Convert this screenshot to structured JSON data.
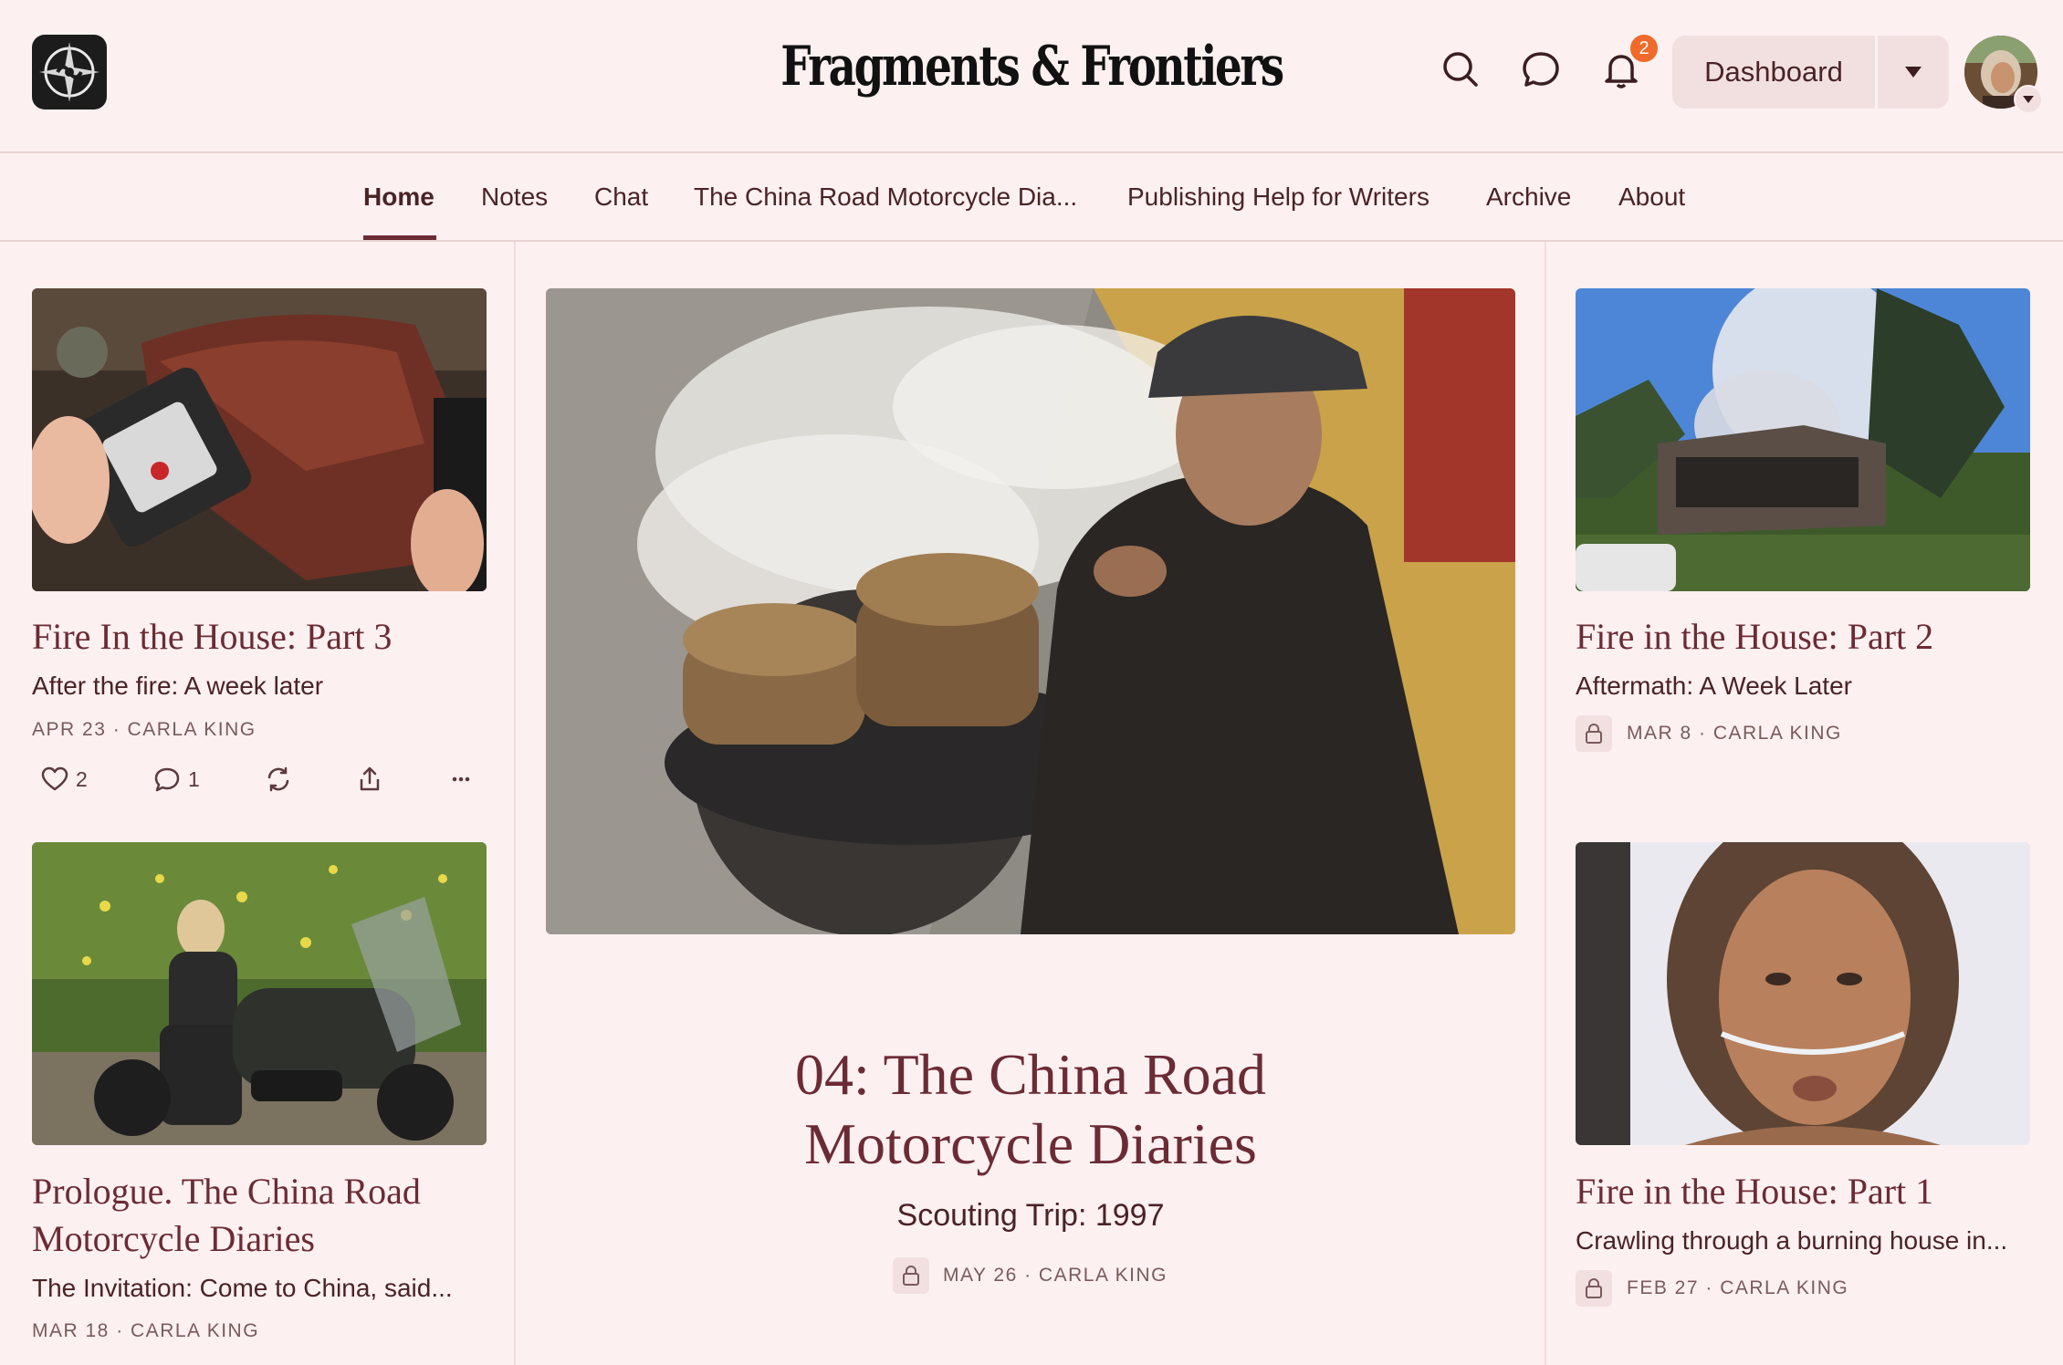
{
  "header": {
    "site_title": "Fragments & Frontiers",
    "dashboard_label": "Dashboard",
    "notification_count": "2",
    "icons": [
      "search-icon",
      "chat-bubble-icon",
      "bell-icon",
      "chevron-down-icon"
    ]
  },
  "nav": {
    "items": [
      {
        "label": "Home",
        "active": true
      },
      {
        "label": "Notes"
      },
      {
        "label": "Chat"
      },
      {
        "label": "The China Road Motorcycle Dia..."
      },
      {
        "label": "Publishing Help for Writers"
      },
      {
        "label": "Archive"
      },
      {
        "label": "About"
      }
    ]
  },
  "posts": {
    "left1": {
      "title": "Fire In the House: Part 3",
      "subtitle": "After the fire: A week later",
      "meta": "APR 23 · CARLA KING",
      "likes": "2",
      "comments": "1"
    },
    "left2": {
      "title_line1": "Prologue. The China Road",
      "title_line2": "Motorcycle Diaries",
      "subtitle": "The Invitation: Come to China, said...",
      "meta": "MAR 18 · CARLA KING"
    },
    "hero": {
      "title_line1": "04: The China Road",
      "title_line2": "Motorcycle Diaries",
      "subtitle": "Scouting Trip: 1997",
      "meta": "MAY 26 · CARLA KING",
      "locked": true
    },
    "right1": {
      "title": "Fire in the House: Part 2",
      "subtitle": "Aftermath: A Week Later",
      "meta": "MAR 8 · CARLA KING",
      "locked": true
    },
    "right2": {
      "title": "Fire in the House: Part 1",
      "subtitle": "Crawling through a burning house in...",
      "meta": "FEB 27 · CARLA KING",
      "locked": true
    }
  },
  "colors": {
    "background": "#fdf0f0",
    "title_accent": "#6b2b35",
    "badge": "#ef6a2b"
  }
}
